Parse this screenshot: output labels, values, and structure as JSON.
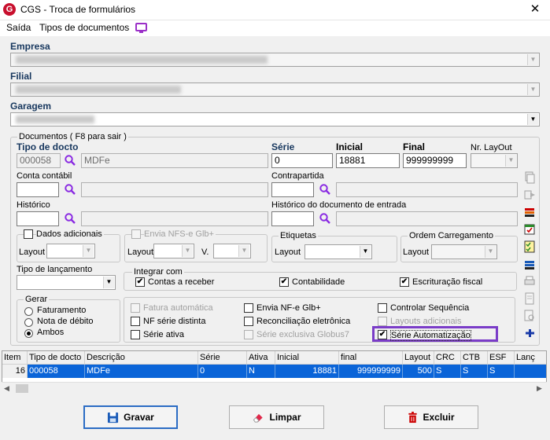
{
  "window": {
    "title": "CGS - Troca de formulários",
    "app_icon": "G",
    "close": "✕"
  },
  "menu": {
    "exit": "Saída",
    "doc_types": "Tipos de documentos"
  },
  "empresa": {
    "label": "Empresa"
  },
  "filial": {
    "label": "Filial"
  },
  "garagem": {
    "label": "Garagem"
  },
  "documentos": {
    "group_title": "Documentos ( F8 para sair )",
    "tipo_docto_label": "Tipo de docto",
    "tipo_docto_code": "000058",
    "tipo_docto_desc": "MDFe",
    "serie_label": "Série",
    "serie_value": "0",
    "inicial_label": "Inicial",
    "inicial_value": "18881",
    "final_label": "Final",
    "final_value": "999999999",
    "nr_layout_label": "Nr. LayOut",
    "conta_contabil_label": "Conta contábil",
    "contrapartida_label": "Contrapartida",
    "historico_label": "Histórico",
    "historico_entrada_label": "Histórico do documento de entrada",
    "dados_adicionais_label": "Dados adicionais",
    "layout_label": "Layout",
    "envia_nfse_label": "Envia NFS-e Glb+",
    "v_label": "V.",
    "etiquetas_label": "Etiquetas",
    "ordem_carregamento_label": "Ordem Carregamento",
    "tipo_lancamento_label": "Tipo de lançamento",
    "integrar_com_label": "Integrar com",
    "contas_receber_label": "Contas a receber",
    "contabilidade_label": "Contabilidade",
    "escrituracao_fiscal_label": "Escrituração fiscal",
    "gerar_label": "Gerar",
    "faturamento_label": "Faturamento",
    "nota_debito_label": "Nota de débito",
    "ambos_label": "Ambos",
    "fatura_automatica_label": "Fatura automática",
    "envia_nfe_label": "Envia NF-e Glb+",
    "controlar_sequencia_label": "Controlar Sequência",
    "nf_serie_distinta_label": "NF série distinta",
    "reconciliacao_label": "Reconciliação eletrônica",
    "layouts_adicionais_label": "Layouts adicionais",
    "serie_ativa_label": "Série ativa",
    "serie_exclusiva_label": "Série exclusiva Globus7",
    "serie_automatizacao_label": "Série Automatização",
    "check_mark": "✔"
  },
  "grid": {
    "headers": [
      "Item",
      "Tipo de docto",
      "Descrição",
      "Série",
      "Ativa",
      "Inicial",
      "final",
      "Layout",
      "CRC",
      "CTB",
      "ESF",
      "Lanç"
    ],
    "rows": [
      [
        "16",
        "000058",
        "MDFe",
        "0",
        "N",
        "18881",
        "999999999",
        "500",
        "S",
        "S",
        "S",
        ""
      ]
    ]
  },
  "buttons": {
    "gravar": "Gravar",
    "limpar": "Limpar",
    "excluir": "Excluir"
  },
  "colors": {
    "accent_purple": "#7a3cc8",
    "selection_blue": "#0a64d8",
    "label_blue": "#17375e"
  }
}
